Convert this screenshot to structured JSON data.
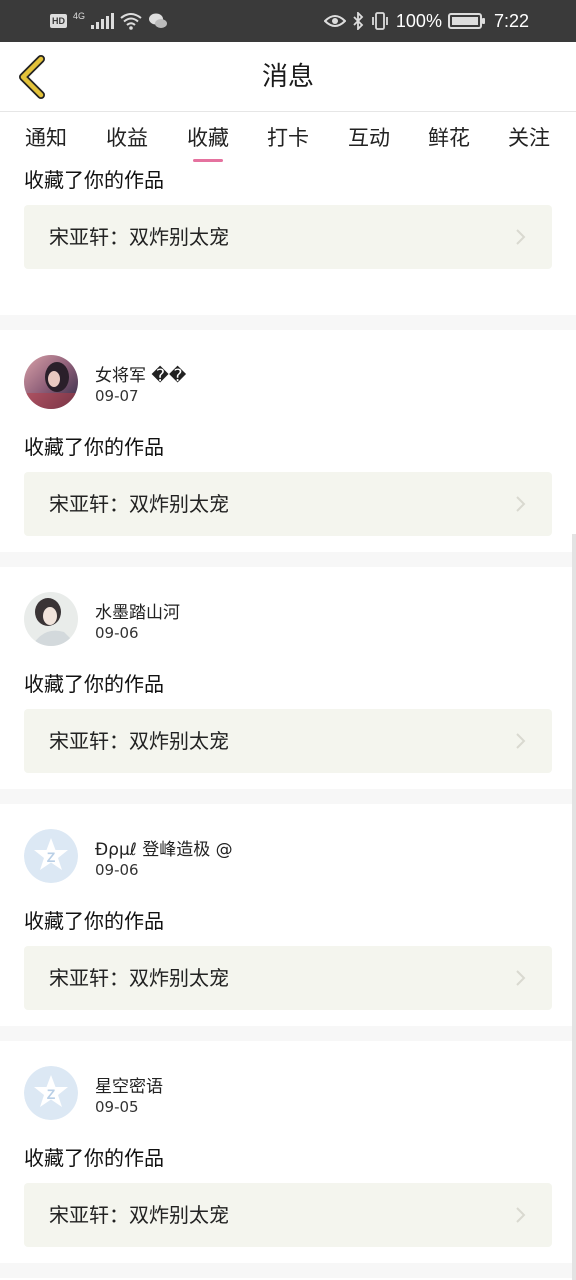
{
  "status_bar": {
    "hd": "HD",
    "network": "4G",
    "battery": "100%",
    "battery_level": 1.0,
    "time": "7:22",
    "icons": [
      "hd-icon",
      "signal-icon",
      "wifi-icon",
      "wechat-icon",
      "eye-icon",
      "bluetooth-icon",
      "vibrate-icon",
      "battery-icon"
    ]
  },
  "header": {
    "title": "消息",
    "back_icon": "chevron-left-icon",
    "back_color": "#e3c23a"
  },
  "tabs": [
    {
      "label": "通知",
      "active": false
    },
    {
      "label": "收益",
      "active": false
    },
    {
      "label": "收藏",
      "active": true
    },
    {
      "label": "打卡",
      "active": false
    },
    {
      "label": "互动",
      "active": false
    },
    {
      "label": "鲜花",
      "active": false
    },
    {
      "label": "关注",
      "active": false
    }
  ],
  "accent_color": "#e5729f",
  "items": [
    {
      "name": "",
      "date": "",
      "action": "收藏了你的作品",
      "work": "宋亚轩：双炸别太宠"
    },
    {
      "name": "女将军 ��",
      "date": "09-07",
      "action": "收藏了你的作品",
      "work": "宋亚轩：双炸别太宠"
    },
    {
      "name": "水墨踏山河",
      "date": "09-06",
      "action": "收藏了你的作品",
      "work": "宋亚轩：双炸别太宠"
    },
    {
      "name": "Ɖρμℓ 登峰造极 @",
      "date": "09-06",
      "action": "收藏了你的作品",
      "work": "宋亚轩：双炸别太宠"
    },
    {
      "name": "星空密语",
      "date": "09-05",
      "action": "收藏了你的作品",
      "work": "宋亚轩：双炸别太宠"
    }
  ]
}
